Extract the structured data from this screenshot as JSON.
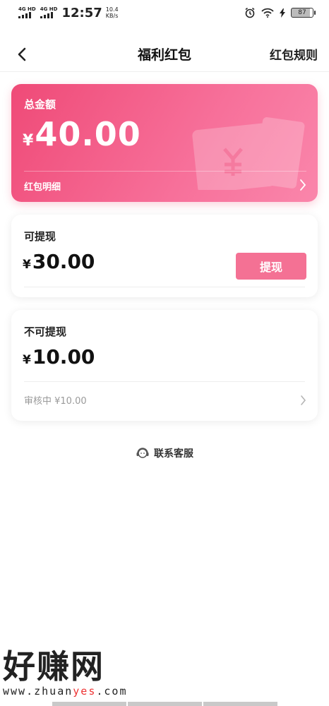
{
  "status_bar": {
    "network_1": "4G HD",
    "network_2": "4G HD",
    "time": "12:57",
    "speed_value": "10.4",
    "speed_unit": "KB/s",
    "battery": "87"
  },
  "nav": {
    "back_icon": "chevron-left-icon",
    "title": "福利红包",
    "rules_link": "红包规则"
  },
  "total_card": {
    "label": "总金额",
    "currency": "¥",
    "amount": "40.00",
    "detail_label": "红包明细",
    "gradient_start": "#ef4a77",
    "gradient_end": "#fa86ab"
  },
  "withdrawable": {
    "title": "可提现",
    "currency": "¥",
    "amount": "30.00",
    "button_label": "提现",
    "button_color": "#f47194"
  },
  "non_withdrawable": {
    "title": "不可提现",
    "currency": "¥",
    "amount": "10.00",
    "review_text": "审核中 ¥10.00"
  },
  "service": {
    "icon": "headset-icon",
    "label": "联系客服"
  },
  "watermark": {
    "title": "好赚网",
    "url_prefix": "www.zhuan",
    "url_highlight": "yes",
    "url_suffix": ".com"
  }
}
